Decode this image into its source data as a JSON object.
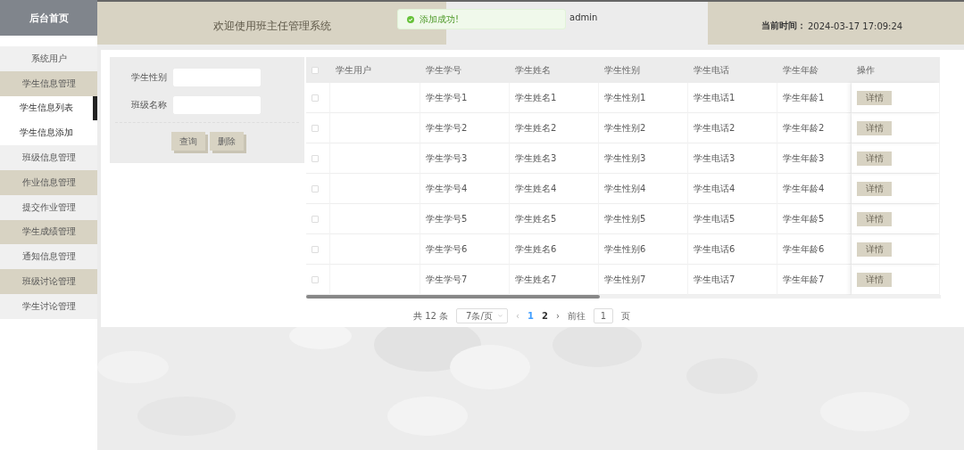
{
  "sidebar": {
    "title": "后台首页",
    "items": [
      {
        "label": "系统用户",
        "kind": "menu"
      },
      {
        "label": "学生信息管理",
        "kind": "menu",
        "children": [
          {
            "label": "学生信息列表",
            "selected": true
          },
          {
            "label": "学生信息添加",
            "selected": false
          }
        ]
      },
      {
        "label": "班级信息管理",
        "kind": "menu"
      },
      {
        "label": "作业信息管理",
        "kind": "menu"
      },
      {
        "label": "提交作业管理",
        "kind": "menu"
      },
      {
        "label": "学生成绩管理",
        "kind": "menu"
      },
      {
        "label": "通知信息管理",
        "kind": "menu"
      },
      {
        "label": "班级讨论管理",
        "kind": "menu"
      },
      {
        "label": "学生讨论管理",
        "kind": "menu"
      }
    ]
  },
  "header": {
    "title": "欢迎使用班主任管理系统",
    "user": "admin",
    "time_label": "当前时间：",
    "time": "2024-03-17 17:09:24"
  },
  "toast": {
    "message": "添加成功!"
  },
  "search": {
    "fields": [
      {
        "label": "学生性别"
      },
      {
        "label": "班级名称"
      }
    ],
    "buttons": [
      "查询",
      "删除"
    ]
  },
  "table": {
    "select_all": false,
    "columns": [
      "学生用户",
      "学生学号",
      "学生姓名",
      "学生性别",
      "学生电话",
      "学生年龄",
      "操作"
    ],
    "rows": [
      {
        "checked": false,
        "cells": [
          "",
          "学生学号1",
          "学生姓名1",
          "学生性别1",
          "学生电话1",
          "学生年龄1"
        ],
        "action": "详情"
      },
      {
        "checked": false,
        "cells": [
          "",
          "学生学号2",
          "学生姓名2",
          "学生性别2",
          "学生电话2",
          "学生年龄2"
        ],
        "action": "详情"
      },
      {
        "checked": false,
        "cells": [
          "",
          "学生学号3",
          "学生姓名3",
          "学生性别3",
          "学生电话3",
          "学生年龄3"
        ],
        "action": "详情"
      },
      {
        "checked": false,
        "cells": [
          "",
          "学生学号4",
          "学生姓名4",
          "学生性别4",
          "学生电话4",
          "学生年龄4"
        ],
        "action": "详情"
      },
      {
        "checked": false,
        "cells": [
          "",
          "学生学号5",
          "学生姓名5",
          "学生性别5",
          "学生电话5",
          "学生年龄5"
        ],
        "action": "详情"
      },
      {
        "checked": false,
        "cells": [
          "",
          "学生学号6",
          "学生姓名6",
          "学生性别6",
          "学生电话6",
          "学生年龄6"
        ],
        "action": "详情"
      },
      {
        "checked": false,
        "cells": [
          "",
          "学生学号7",
          "学生姓名7",
          "学生性别7",
          "学生电话7",
          "学生年龄7"
        ],
        "action": "详情"
      }
    ]
  },
  "pagination": {
    "total": "共 12 条",
    "page_size": "7条/页",
    "prev": "‹",
    "pages": [
      {
        "label": "1",
        "selected": true
      },
      {
        "label": "2",
        "selected": false
      }
    ],
    "next": "›",
    "goto_label": "前往",
    "goto_value": "1",
    "goto_suffix": "页"
  }
}
